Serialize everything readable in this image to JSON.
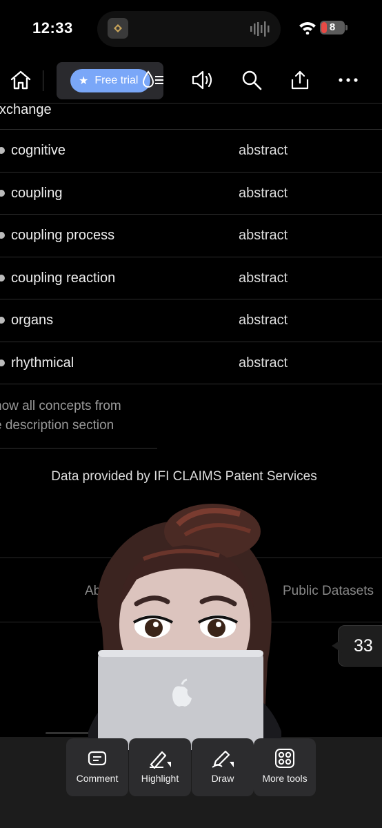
{
  "status_bar": {
    "time": "12:33",
    "battery_level": "8",
    "icons": [
      "app-icon",
      "audio-wave-icon",
      "wifi-icon",
      "battery-icon"
    ]
  },
  "toolbar": {
    "free_trial_label": "Free trial",
    "icons": [
      "home-icon",
      "star-icon",
      "ink-drop-list-icon",
      "speaker-icon",
      "search-icon",
      "share-icon",
      "more-icon"
    ]
  },
  "content": {
    "truncated_top": "xchange",
    "rows": [
      {
        "concept": "cognitive",
        "section": "abstract"
      },
      {
        "concept": "coupling",
        "section": "abstract"
      },
      {
        "concept": "coupling process",
        "section": "abstract"
      },
      {
        "concept": "coupling reaction",
        "section": "abstract"
      },
      {
        "concept": "organs",
        "section": "abstract"
      },
      {
        "concept": "rhythmical",
        "section": "abstract"
      }
    ],
    "show_all_line1": "how all concepts from",
    "show_all_line2": "e description section",
    "data_provided": "Data provided by IFI CLAIMS Patent Services"
  },
  "footer": {
    "link_about": "Abo",
    "link_public_datasets": "Public Datasets"
  },
  "page_number": "33",
  "dock": {
    "items": [
      {
        "label": "Comment",
        "icon": "comment-icon"
      },
      {
        "label": "Highlight",
        "icon": "highlight-icon"
      },
      {
        "label": "Draw",
        "icon": "draw-icon"
      },
      {
        "label": "More tools",
        "icon": "more-tools-icon"
      }
    ]
  },
  "colors": {
    "background": "#000000",
    "accent": "#7aa7f8",
    "battery_low": "#e64a45"
  }
}
